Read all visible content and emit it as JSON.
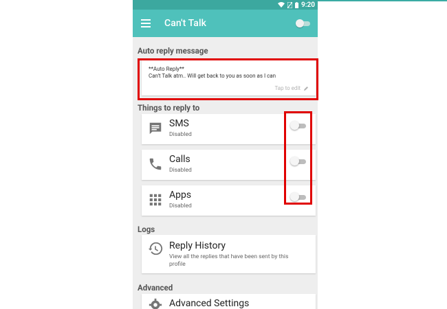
{
  "status_bar": {
    "time": "9:20"
  },
  "app_bar": {
    "title": "Can't Talk"
  },
  "auto_reply": {
    "section_label": "Auto reply message",
    "message_line1": "**Auto Reply**",
    "message_line2": "Can't Talk atm.. Will get back to you as soon as I can",
    "edit_hint": "Tap to edit"
  },
  "things_to_reply": {
    "section_label": "Things to reply to",
    "items": [
      {
        "title": "SMS",
        "status": "Disabled",
        "icon": "message-icon"
      },
      {
        "title": "Calls",
        "status": "Disabled",
        "icon": "phone-icon"
      },
      {
        "title": "Apps",
        "status": "Disabled",
        "icon": "apps-grid-icon"
      }
    ]
  },
  "logs": {
    "section_label": "Logs",
    "title": "Reply History",
    "description": "View all the replies that have been sent by this profile",
    "icon": "history-icon"
  },
  "advanced": {
    "section_label": "Advanced",
    "title": "Advanced Settings",
    "icon": "gear-icon"
  },
  "colors": {
    "app_bar": "#4fc1bb",
    "status_bar": "#3ca89f",
    "highlight": "#e00000",
    "background": "#eeeeee"
  }
}
